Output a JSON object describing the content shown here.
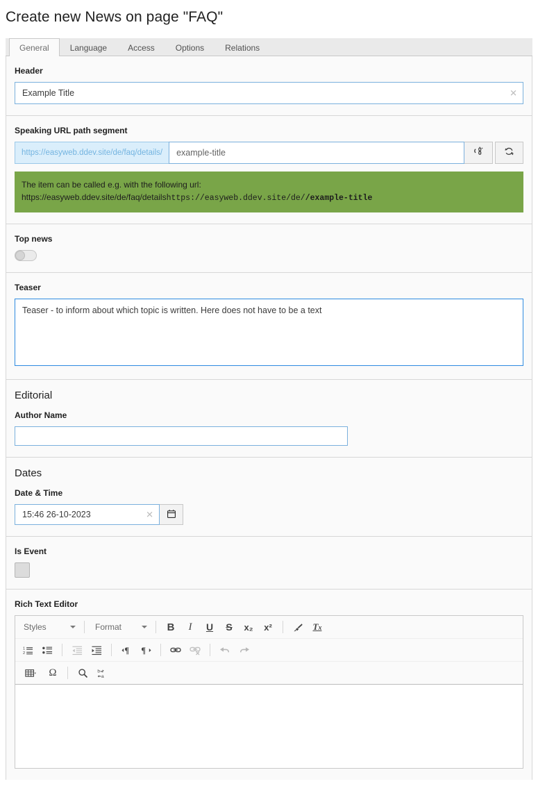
{
  "page": {
    "title": "Create new News on page \"FAQ\""
  },
  "tabs": [
    {
      "label": "General",
      "active": true
    },
    {
      "label": "Language",
      "active": false
    },
    {
      "label": "Access",
      "active": false
    },
    {
      "label": "Options",
      "active": false
    },
    {
      "label": "Relations",
      "active": false
    }
  ],
  "header_field": {
    "label": "Header",
    "value": "Example Title",
    "clear_glyph": "✕"
  },
  "url_field": {
    "label": "Speaking URL path segment",
    "prefix": "https://easyweb.ddev.site/de/faq/details/",
    "value": "example-title",
    "buttons": [
      {
        "icon": "unlink-icon",
        "title": ""
      },
      {
        "icon": "refresh-icon",
        "title": ""
      }
    ],
    "callout": {
      "line1": "The item can be called e.g. with the following url:",
      "line2_plain": "https://easyweb.ddev.site/de/faq/details",
      "line2_mono": "https://easyweb.ddev.site/de/",
      "line2_mono_bold": "example-title",
      "bg_color": "#79a548"
    }
  },
  "top_news": {
    "label": "Top news",
    "state": "off"
  },
  "teaser": {
    "label": "Teaser",
    "value": "Teaser - to inform about which topic is written. Here does not have to be a text"
  },
  "editorial": {
    "heading": "Editorial",
    "author_label": "Author Name",
    "author_value": ""
  },
  "dates": {
    "heading": "Dates",
    "datetime_label": "Date & Time",
    "datetime_value": "15:46 26-10-2023",
    "clear_glyph": "✕",
    "calendar_icon": "calendar-icon"
  },
  "is_event": {
    "label": "Is Event",
    "checked": false
  },
  "rich_text_editor": {
    "label": "Rich Text Editor",
    "styles_combo": "Styles",
    "format_combo": "Format",
    "content": "",
    "toolbar_row1": [
      {
        "name": "bold-button",
        "glyph": "B"
      },
      {
        "name": "italic-button",
        "glyph": "I"
      },
      {
        "name": "underline-button",
        "glyph": "U"
      },
      {
        "name": "strikethrough-button",
        "glyph": "S"
      },
      {
        "name": "subscript-button",
        "glyph": "x₂"
      },
      {
        "name": "superscript-button",
        "glyph": "x²"
      },
      {
        "name": "copy-formatting-button",
        "glyph": "brush"
      },
      {
        "name": "remove-format-button",
        "glyph": "Tx"
      }
    ],
    "toolbar_row2": [
      {
        "name": "numbered-list-button",
        "state": "enabled"
      },
      {
        "name": "bulleted-list-button",
        "state": "enabled"
      },
      {
        "name": "decrease-indent-button",
        "state": "disabled"
      },
      {
        "name": "increase-indent-button",
        "state": "enabled"
      },
      {
        "name": "text-direction-ltr-button",
        "state": "enabled"
      },
      {
        "name": "text-direction-rtl-button",
        "state": "enabled"
      },
      {
        "name": "link-button",
        "state": "enabled"
      },
      {
        "name": "unlink-button",
        "state": "disabled"
      },
      {
        "name": "undo-button",
        "state": "grey"
      },
      {
        "name": "redo-button",
        "state": "grey"
      }
    ],
    "toolbar_row3": [
      {
        "name": "table-button",
        "state": "enabled"
      },
      {
        "name": "special-character-button",
        "state": "enabled"
      },
      {
        "name": "find-button",
        "state": "enabled"
      },
      {
        "name": "replace-button",
        "state": "enabled"
      }
    ]
  }
}
